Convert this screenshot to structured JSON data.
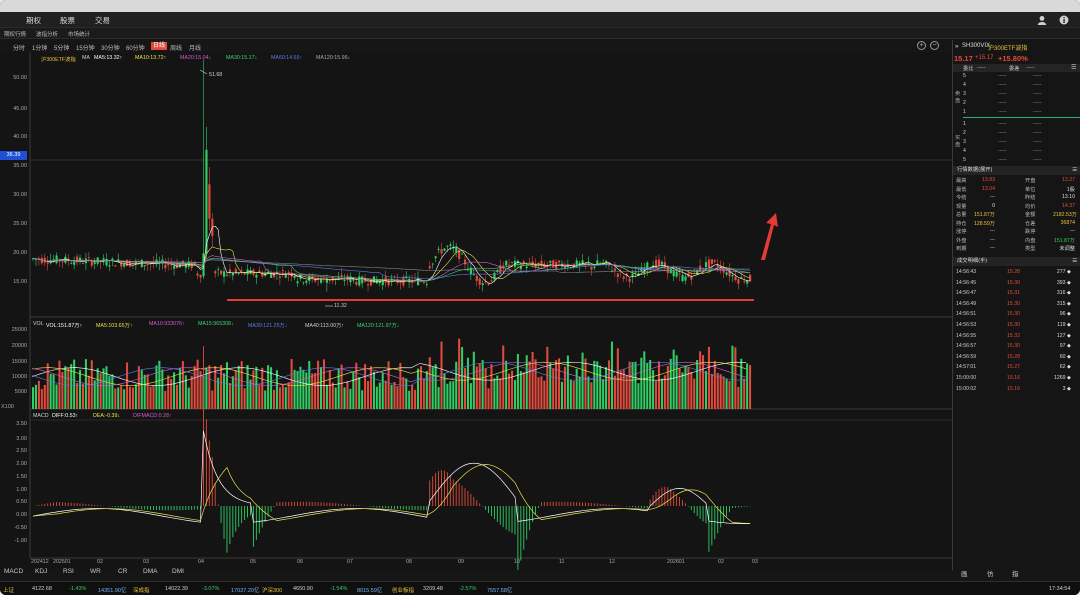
{
  "menu": {
    "items": [
      "期权",
      "股票",
      "交易"
    ]
  },
  "subnav": {
    "items": [
      "期权行情",
      "波指分析",
      "市场统计"
    ]
  },
  "periods": {
    "items": [
      "分时",
      "1分钟",
      "5分钟",
      "15分钟",
      "30分钟",
      "60分钟",
      "日线",
      "周线",
      "月线"
    ],
    "active": "日线"
  },
  "main_legend": {
    "name": "沪300ETF波指",
    "ma": "MA",
    "ma5": "MA5:13.32↑",
    "ma10": "MA10:13.72↑",
    "ma20": "MA20:15.04↓",
    "ma30": "MA30:15.17↓",
    "ma60": "MA60:14.65↑",
    "ma120": "MA120:15.96↓"
  },
  "vol_legend": {
    "name": "VOL",
    "vol": "VOL:151.87万↑",
    "ma5": "MA5:103.65万↑",
    "ma10": "MA10:933076↑",
    "ma15": "MA15:965308↓",
    "ma30": "MA30:121.25万↓",
    "ma40": "MA40:113.00万↑",
    "ma120": "MA120:121.97万↓"
  },
  "macd_legend": {
    "name": "MACD",
    "diff": "DIFF:0.53↑",
    "dea": "DEA:-0.39↓",
    "difmacd": "DIFMACD:0.28↑"
  },
  "axes": {
    "price_ticks": [
      "50.00",
      "45.00",
      "40.00",
      "35.00",
      "30.00",
      "25.00",
      "20.00",
      "15.00"
    ],
    "price_marker": "36.39",
    "vol_ticks": [
      "25000",
      "20000",
      "15000",
      "10000",
      "5000"
    ],
    "vol_unit": "X100",
    "macd_ticks": [
      "3.50",
      "3.00",
      "2.50",
      "2.00",
      "1.50",
      "1.00",
      "0.50",
      "0.00",
      "-0.50",
      "-1.00"
    ],
    "x_labels": [
      "202412",
      "202501",
      "02",
      "03",
      "04",
      "05",
      "06",
      "07",
      "08",
      "09",
      "10",
      "11",
      "12",
      "202601",
      "02",
      "03"
    ],
    "high_label": "51.68",
    "low_label": "11.32"
  },
  "indicator_tabs": [
    "MACD",
    "KDJ",
    "RSI",
    "WR",
    "CR",
    "DMA",
    "DMI"
  ],
  "right_tabs": [
    "画",
    "仿",
    "指"
  ],
  "quote": {
    "code": "SH300VIX",
    "name": "沪300ETF波指",
    "price": "15.17",
    "change": "+15.17",
    "pct": "+15.80%",
    "headers": [
      "委比",
      "-----",
      "委差",
      "-----"
    ],
    "sell_label": "卖盘",
    "buy_label": "买盘",
    "levels": [
      "5",
      "4",
      "3",
      "2",
      "1",
      "1",
      "2",
      "3",
      "4",
      "5"
    ],
    "placeholder": "-----"
  },
  "stats": {
    "title": "行情数据(展开)",
    "rows": [
      [
        "最高",
        "13.83",
        "开盘",
        "13.27"
      ],
      [
        "最低",
        "13.04",
        "单位",
        "1股"
      ],
      [
        "今结",
        "---",
        "昨结",
        "13.10"
      ],
      [
        "现量",
        "0",
        "均价",
        "14.37"
      ],
      [
        "总量",
        "151.87万",
        "金额",
        "2182.53万"
      ],
      [
        "持仓",
        "128.59万",
        "仓差",
        "36874"
      ],
      [
        "涨停",
        "---",
        "跌停",
        "---"
      ],
      [
        "外盘",
        "---",
        "内盘",
        "151.87万"
      ],
      [
        "到期",
        "---",
        "类型",
        "未调整"
      ]
    ]
  },
  "trades": {
    "title": "成交明细(手)",
    "rows": [
      [
        "14:56:43",
        "15.28",
        "277"
      ],
      [
        "14:56:45",
        "15.30",
        "393"
      ],
      [
        "14:56:47",
        "15.31",
        "316"
      ],
      [
        "14:56:49",
        "15.30",
        "315"
      ],
      [
        "14:56:51",
        "15.30",
        "96"
      ],
      [
        "14:56:53",
        "15.30",
        "119"
      ],
      [
        "14:56:55",
        "15.32",
        "127"
      ],
      [
        "14:56:57",
        "15.30",
        "97"
      ],
      [
        "14:56:59",
        "15.28",
        "60"
      ],
      [
        "14:57:01",
        "15.27",
        "62"
      ],
      [
        "15:00:00",
        "15.16",
        "1269"
      ],
      [
        "15:00:02",
        "15.16",
        "3"
      ]
    ]
  },
  "status": {
    "items": [
      {
        "name": "上证",
        "value": "4122.68",
        "pct": "-1.43%",
        "amount": "14351.90亿"
      },
      {
        "name": "深成指",
        "value": "14022.39",
        "pct": "-3.07%",
        "amount": "17037.20亿"
      },
      {
        "name": "沪深300",
        "value": "4650.90",
        "pct": "-1.54%",
        "amount": "8015.59亿"
      },
      {
        "name": "创业板指",
        "value": "3209.48",
        "pct": "-2.57%",
        "amount": "7557.58亿"
      }
    ],
    "time": "17:34:54"
  },
  "colors": {
    "up": "#e24b3b",
    "down": "#2fcf64",
    "bg": "#141414",
    "accent": "#e9a63b"
  }
}
